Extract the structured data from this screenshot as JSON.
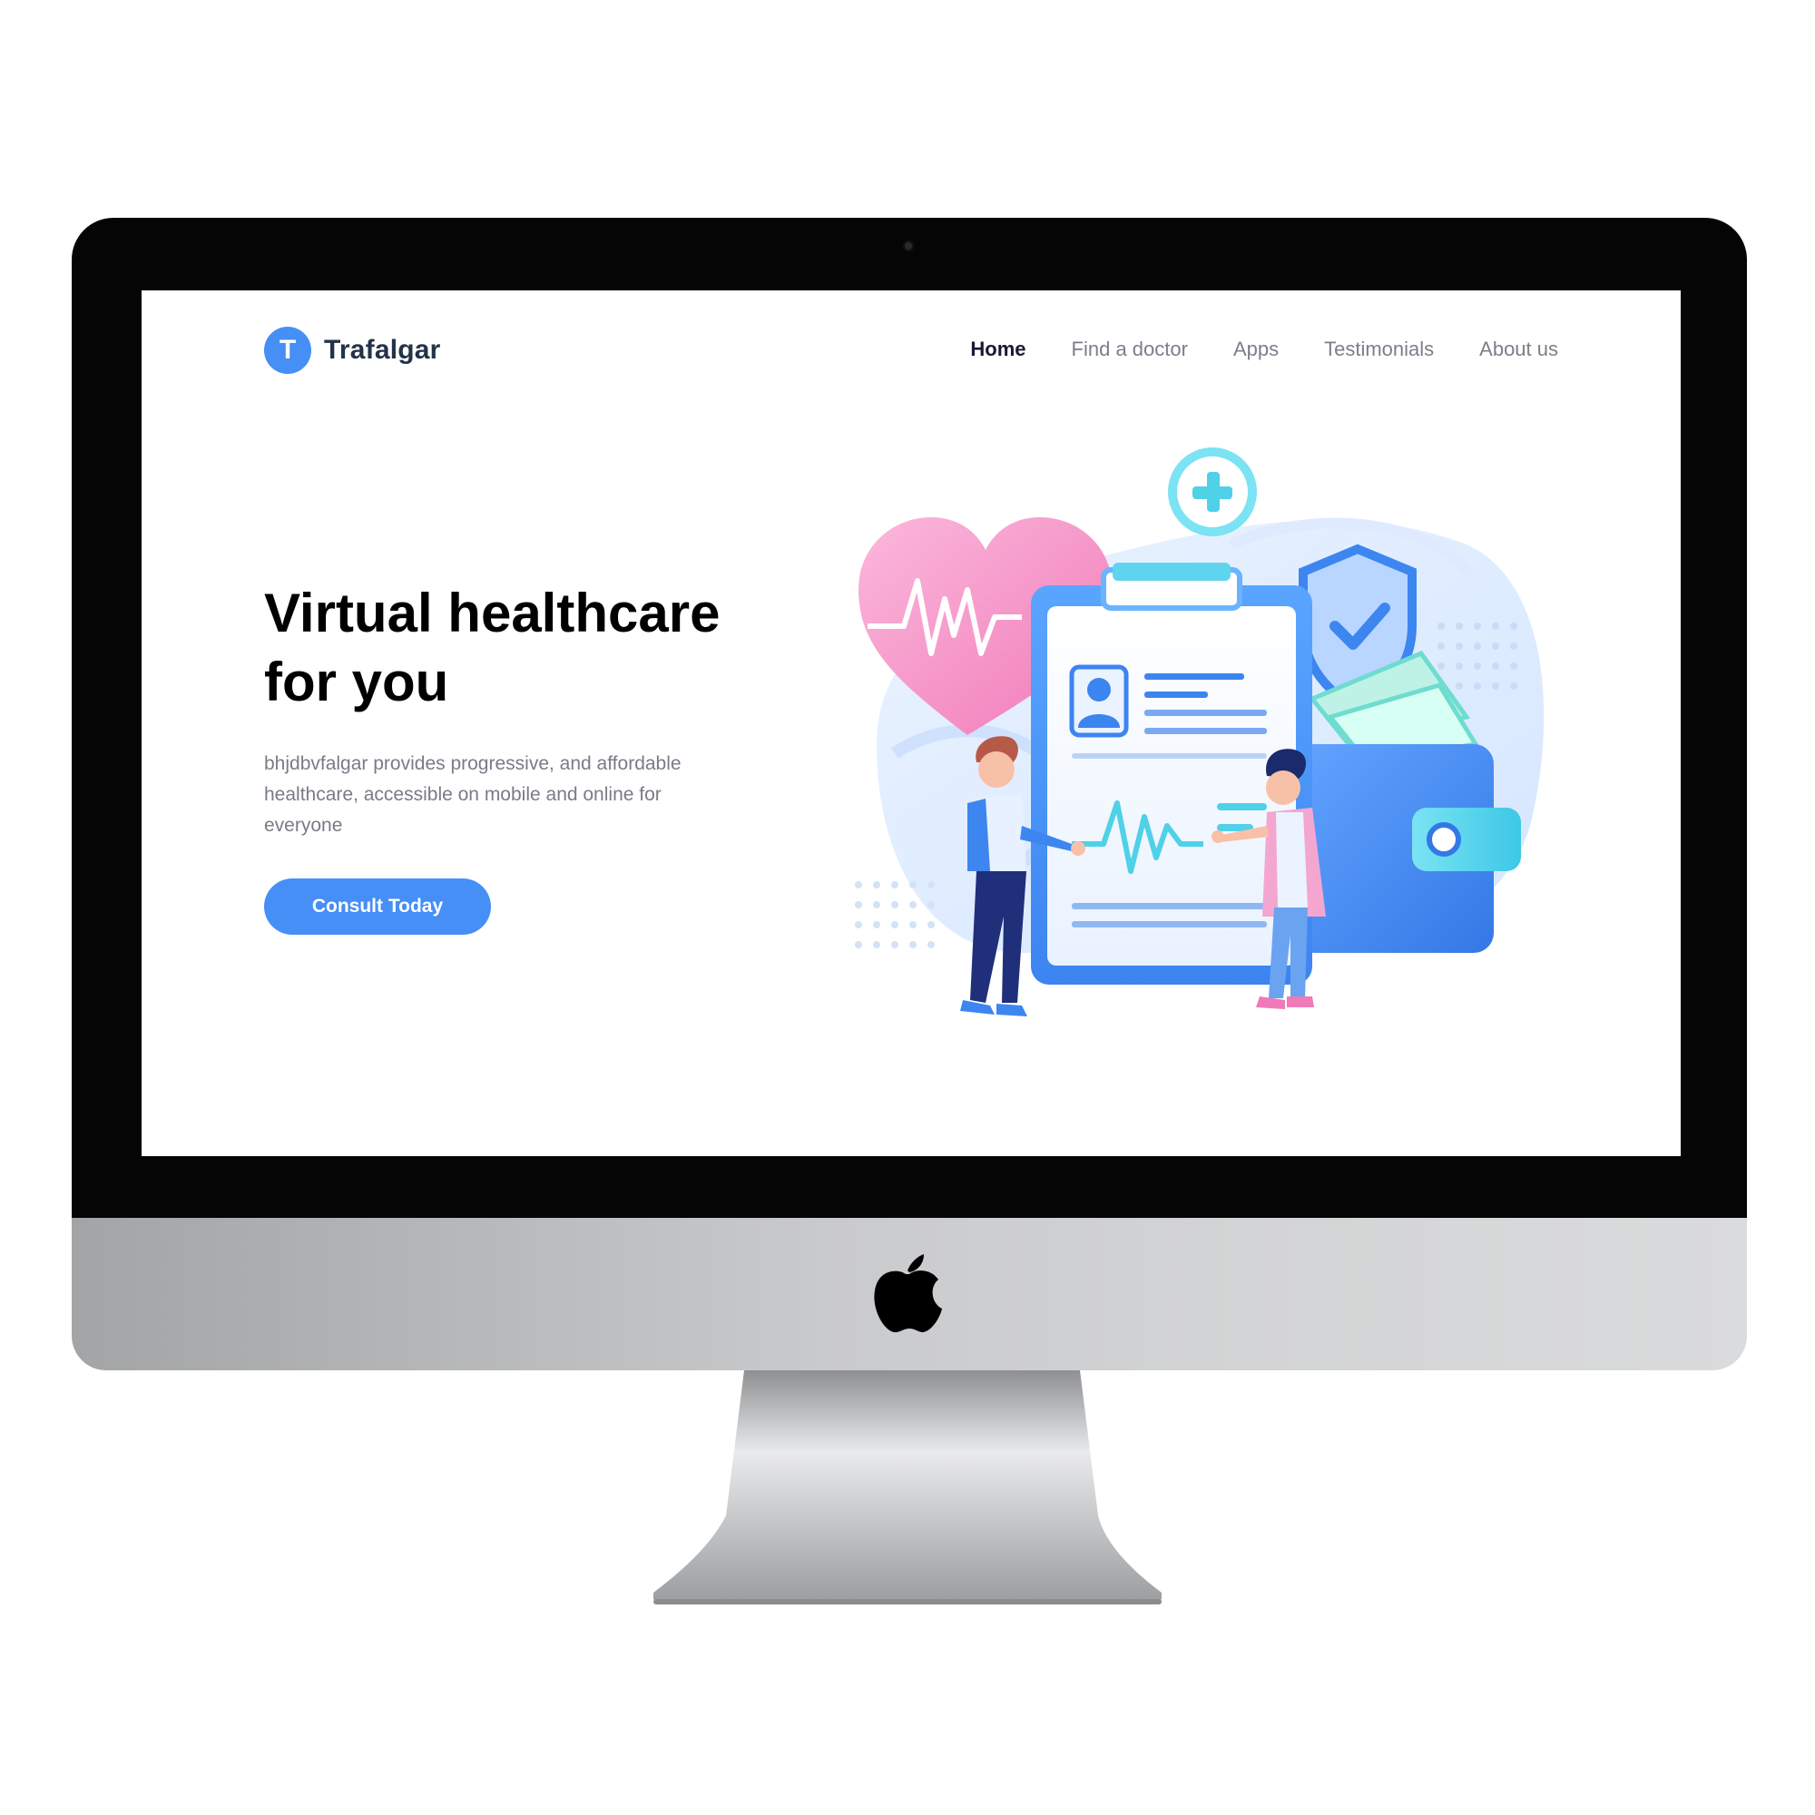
{
  "brand": {
    "logo_letter": "T",
    "name": "Trafalgar",
    "accent": "#458ff6"
  },
  "nav": {
    "items": [
      {
        "label": "Home",
        "active": true
      },
      {
        "label": "Find a doctor",
        "active": false
      },
      {
        "label": "Apps",
        "active": false
      },
      {
        "label": "Testimonials",
        "active": false
      },
      {
        "label": "About us",
        "active": false
      }
    ]
  },
  "hero": {
    "title_line1": "Virtual healthcare",
    "title_line2": "for you",
    "description": "bhjdbvfalgar provides progressive, and affordable healthcare, accessible on mobile and online for everyone",
    "cta_label": "Consult Today"
  },
  "colors": {
    "primary": "#458ff6",
    "heading": "#000000",
    "body_text": "#7d7987",
    "nav_active": "#1f1534",
    "nav_inactive": "#7b7f8a",
    "heart_pink": "#f598c9",
    "teal": "#4fd1e8"
  },
  "icons": {
    "hero_illustration": "healthcare-illustration",
    "device_logo": "apple-logo-icon"
  }
}
